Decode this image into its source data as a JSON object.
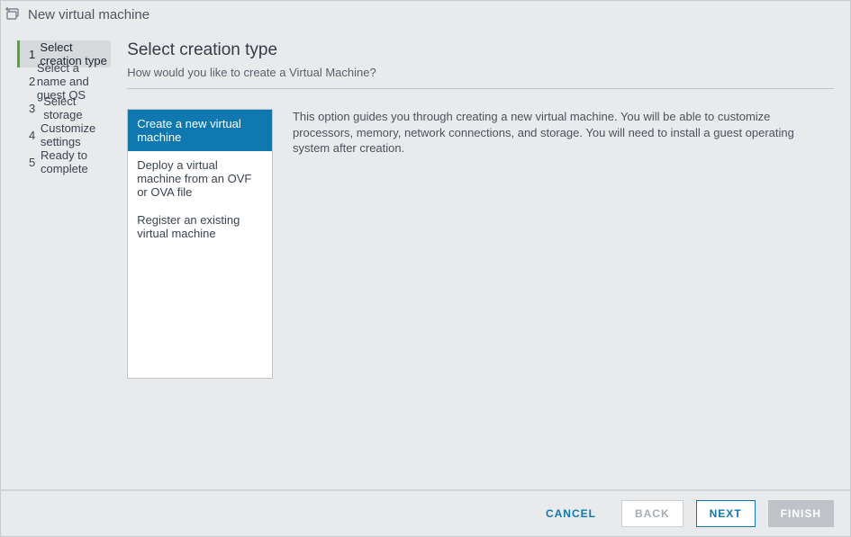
{
  "header": {
    "title": "New virtual machine"
  },
  "sidebar": {
    "steps": [
      {
        "num": "1",
        "label": "Select creation type"
      },
      {
        "num": "2",
        "label": "Select a name and guest OS"
      },
      {
        "num": "3",
        "label": "Select storage"
      },
      {
        "num": "4",
        "label": "Customize settings"
      },
      {
        "num": "5",
        "label": "Ready to complete"
      }
    ]
  },
  "main": {
    "title": "Select creation type",
    "subtitle": "How would you like to create a Virtual Machine?",
    "options": [
      "Create a new virtual machine",
      "Deploy a virtual machine from an OVF or OVA file",
      "Register an existing virtual machine"
    ],
    "description": "This option guides you through creating a new virtual machine. You will be able to customize processors, memory, network connections, and storage. You will need to install a guest operating system after creation."
  },
  "footer": {
    "cancel": "Cancel",
    "back": "Back",
    "next": "Next",
    "finish": "Finish"
  }
}
